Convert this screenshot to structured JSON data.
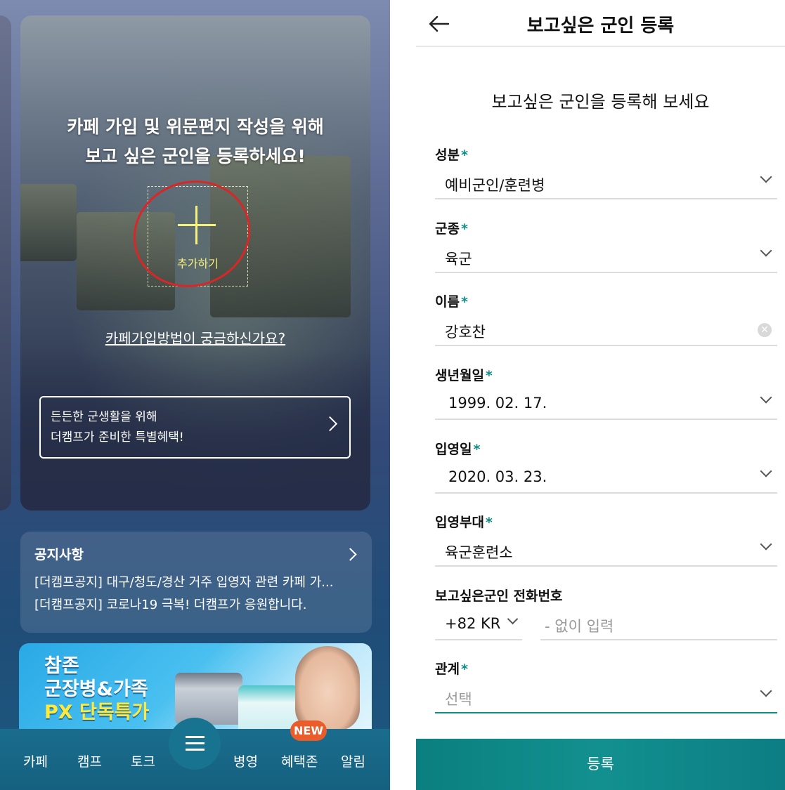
{
  "left": {
    "hero_title_line1": "카페 가입 및 위문편지 작성을 위해",
    "hero_title_line2": "보고 싶은 군인을 등록하세요!",
    "add_label": "추가하기",
    "join_link": "카페가입방법이 궁금하신가요?",
    "benefit_line1": "든든한 군생활을 위해",
    "benefit_line2": "더캠프가 준비한 특별혜택!",
    "notice": {
      "title": "공지사항",
      "items": [
        "[더캠프공지] 대구/청도/경산 거주 입영자 관련 카페 가...",
        "[더캠프공지] 코로나19 극복! 더캠프가 응원합니다."
      ]
    },
    "ad": {
      "line1": "참존",
      "line2": "군장병&가족",
      "line3": "PX 단독특가"
    },
    "nav": {
      "items": [
        "카페",
        "캠프",
        "토크",
        "병영",
        "혜택존",
        "알림"
      ],
      "new_badge": "NEW"
    }
  },
  "right": {
    "title": "보고싶은 군인 등록",
    "subtitle": "보고싶은 군인을 등록해 보세요",
    "fields": {
      "status": {
        "label": "성분",
        "value": "예비군인/훈련병"
      },
      "branch": {
        "label": "군종",
        "value": "육군"
      },
      "name": {
        "label": "이름",
        "value": "강호찬"
      },
      "birth": {
        "label": "생년월일",
        "value": "1999. 02. 17."
      },
      "enlist_date": {
        "label": "입영일",
        "value": "2020. 03. 23."
      },
      "unit": {
        "label": "입영부대",
        "value": "육군훈련소"
      },
      "phone": {
        "label": "보고싶은군인 전화번호",
        "code": "+82 KR",
        "placeholder": "- 없이 입력"
      },
      "relation": {
        "label": "관계",
        "placeholder": "선택"
      }
    },
    "required_mark": "*",
    "submit": "등록",
    "accent_color": "#0e8c86"
  }
}
